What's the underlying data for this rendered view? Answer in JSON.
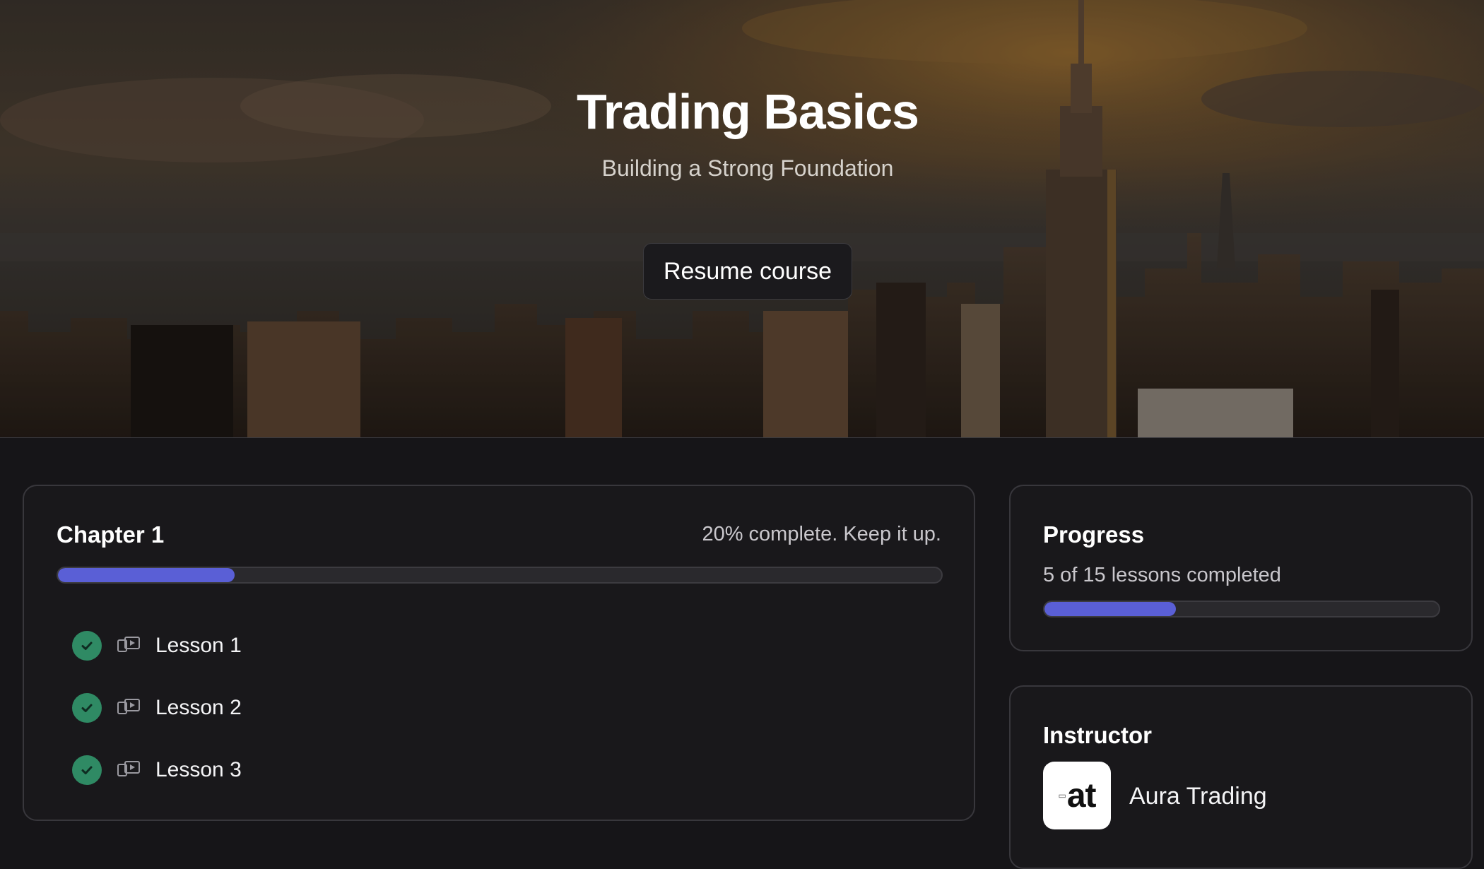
{
  "hero": {
    "title": "Trading Basics",
    "subtitle": "Building a Strong Foundation",
    "resume_label": "Resume course"
  },
  "chapter": {
    "title": "Chapter 1",
    "status_text": "20% complete. Keep it up.",
    "progress_fraction": 0.2,
    "lessons": [
      {
        "label": "Lesson 1",
        "completed": true,
        "icon": "video-icon"
      },
      {
        "label": "Lesson 2",
        "completed": true,
        "icon": "video-icon"
      },
      {
        "label": "Lesson 3",
        "completed": true,
        "icon": "video-icon"
      }
    ]
  },
  "progress": {
    "title": "Progress",
    "summary": "5 of 15 lessons completed",
    "progress_fraction": 0.3333
  },
  "instructor": {
    "title": "Instructor",
    "logo_text": "at",
    "name": "Aura Trading"
  },
  "colors": {
    "accent": "#5a5fd6",
    "complete": "#2f8a64",
    "background": "#161518",
    "card": "#19181b"
  }
}
